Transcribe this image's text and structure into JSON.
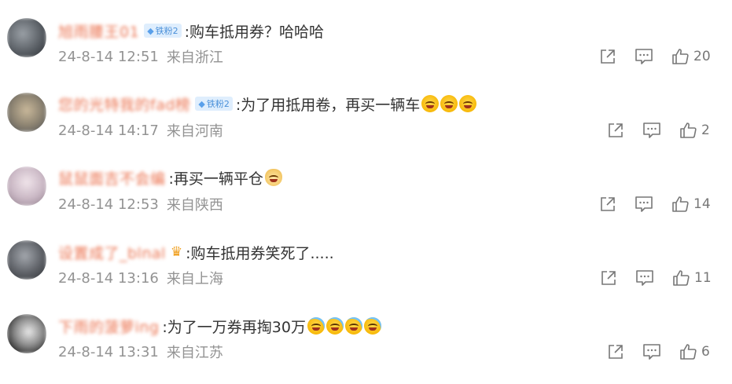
{
  "comments": [
    {
      "username": "旭雨腰王01",
      "badge": "铁粉2",
      "badge_type": "fan",
      "text": ":购车抵用券？哈哈哈",
      "emojis": [],
      "date": "24-8-14 12:51",
      "source": "来自浙江",
      "likes": "20",
      "avatar_color": "#6b6f73"
    },
    {
      "username": "您的光特我的fad榜",
      "badge": "铁粉2",
      "badge_type": "fan",
      "text": ":为了用抵用卷，再买一辆车",
      "emojis": [
        "laugh",
        "laugh",
        "laugh"
      ],
      "date": "24-8-14 14:17",
      "source": "来自河南",
      "likes": "2",
      "avatar_color": "#8a8170"
    },
    {
      "username": "鼠鼠面吉不会编",
      "badge": "",
      "badge_type": "",
      "text": ":再买一辆平仓",
      "emojis": [
        "dog"
      ],
      "date": "24-8-14 12:53",
      "source": "来自陕西",
      "likes": "14",
      "avatar_color": "#c9b7c4"
    },
    {
      "username": "设置成了_blnal",
      "badge": "",
      "badge_type": "crown",
      "text": ":购车抵用券笑死了.....",
      "emojis": [],
      "date": "24-8-14 13:16",
      "source": "来自上海",
      "likes": "11",
      "avatar_color": "#5d6066"
    },
    {
      "username": "下雨的菠萝ing",
      "badge": "",
      "badge_type": "",
      "text": ":为了一万券再掏30万",
      "emojis": [
        "cry",
        "cry",
        "cry",
        "cry"
      ],
      "date": "24-8-14 13:31",
      "source": "来自江苏",
      "likes": "6",
      "avatar_color": "#3a3a3a"
    }
  ],
  "icons": {
    "share": "share-icon",
    "comment": "comment-icon",
    "like": "like-icon"
  },
  "colors": {
    "username": "#eb7350",
    "text": "#333333",
    "meta": "#939393",
    "badge_bg": "#dfeefd",
    "badge_text": "#4a90d9"
  }
}
